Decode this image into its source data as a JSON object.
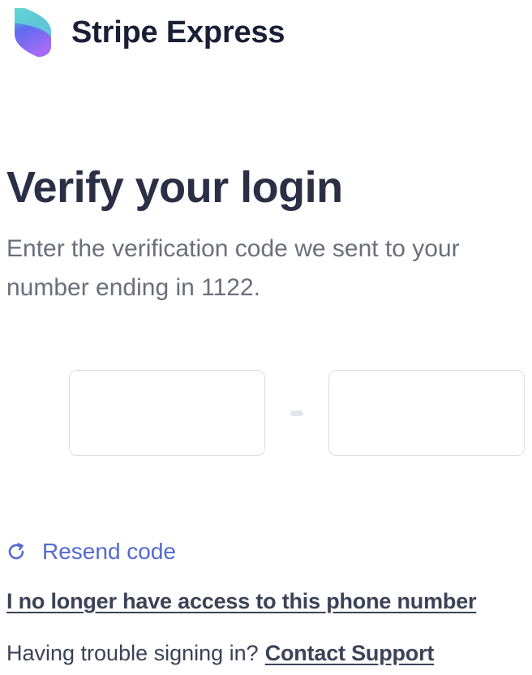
{
  "brand": {
    "name": "Stripe Express",
    "logo_icon": "stripe-express-logo-icon",
    "colors": {
      "logo_top": "#6ee0d6",
      "logo_mid": "#5b6cf0",
      "logo_bottom": "#9b6bf5"
    }
  },
  "header": {
    "title": "Verify your login",
    "subtitle": "Enter the verification code we sent to your number ending in 1122."
  },
  "verification": {
    "groups": [
      {
        "cells": [
          "",
          "",
          ""
        ]
      },
      {
        "cells": [
          "",
          "",
          ""
        ]
      }
    ],
    "separator": "-"
  },
  "actions": {
    "resend_label": "Resend code",
    "resend_icon": "refresh-icon",
    "no_access_label": "I no longer have access to this phone number",
    "trouble_text": "Having trouble signing in?",
    "contact_label": "Contact Support"
  },
  "colors": {
    "link": "#5469d4",
    "title": "#2a2f45",
    "body": "#6b6f7b"
  }
}
